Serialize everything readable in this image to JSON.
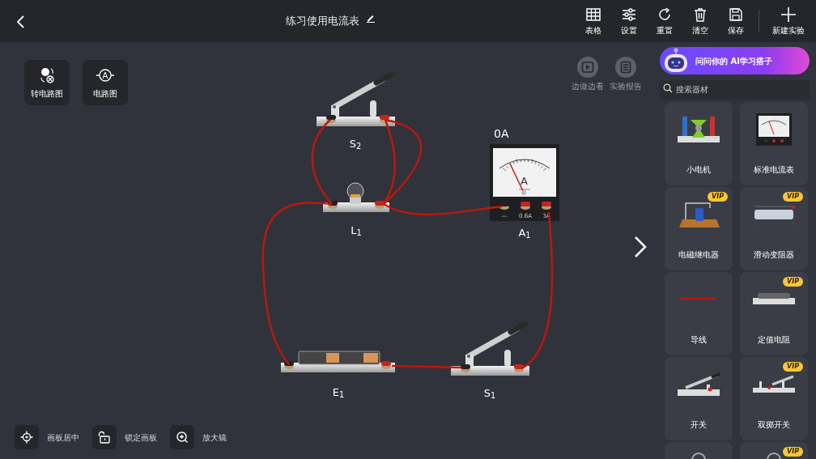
{
  "header": {
    "title": "练习使用电流表",
    "toolbar": [
      {
        "kind": "table",
        "label": "表格"
      },
      {
        "kind": "settings",
        "label": "设置"
      },
      {
        "kind": "reset",
        "label": "重置"
      },
      {
        "kind": "clear",
        "label": "清空"
      },
      {
        "kind": "save",
        "label": "保存"
      },
      {
        "kind": "new",
        "label": "新建实验"
      }
    ]
  },
  "view_tools": [
    {
      "kind": "convert",
      "label": "转电路图"
    },
    {
      "kind": "diagram",
      "label": "电路图",
      "symbol": "A"
    }
  ],
  "side_tools": [
    {
      "kind": "play",
      "label": "边做边看"
    },
    {
      "kind": "report",
      "label": "实验报告"
    }
  ],
  "components": [
    {
      "kind": "switch",
      "label": "S$_{2}$"
    },
    {
      "kind": "bulb",
      "label": "L$_{1}$"
    },
    {
      "kind": "ammeter",
      "label": "A$_{1}$",
      "reading": "0A",
      "unit": "A",
      "terminals": [
        "—",
        "0.6A",
        "3A"
      ]
    },
    {
      "kind": "battery",
      "label": "E$_{1}$"
    },
    {
      "kind": "switch",
      "label": "S$_{1}$"
    }
  ],
  "canvas_tools": [
    {
      "kind": "center",
      "label": "画板居中"
    },
    {
      "kind": "lock",
      "label": "锁定画板"
    },
    {
      "kind": "zoom",
      "label": "放大镜"
    }
  ],
  "sidebar": {
    "ai_banner": "问问你的 AI学习搭子",
    "search": {
      "placeholder": "搜索器材"
    },
    "items": [
      {
        "kind": "motor",
        "label": "小电机"
      },
      {
        "kind": "ammeter",
        "label": "标准电流表"
      },
      {
        "kind": "relay",
        "badge": "VIP",
        "label": "电磁继电器"
      },
      {
        "kind": "rheostat",
        "badge": "VIP",
        "label": "滑动变阻器"
      },
      {
        "kind": "wire",
        "label": "导线"
      },
      {
        "kind": "resistor",
        "badge": "VIP",
        "label": "定值电阻"
      },
      {
        "kind": "switch",
        "label": "开关"
      },
      {
        "kind": "dpdt",
        "badge": "VIP",
        "label": "双掷开关"
      },
      {
        "kind": "bulb"
      },
      {
        "kind": "bulb",
        "badge": "VIP"
      }
    ]
  }
}
